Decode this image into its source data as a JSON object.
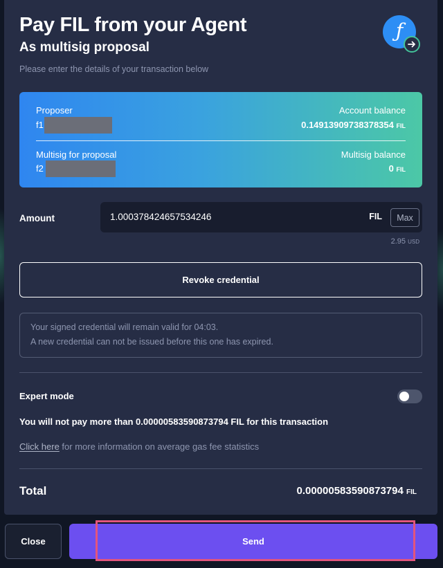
{
  "header": {
    "title": "Pay FIL from your Agent",
    "subtitle": "As multisig proposal",
    "instructions": "Please enter the details of your transaction below",
    "icon": "filecoin-icon",
    "badge_icon": "arrow-right-icon"
  },
  "card": {
    "proposer_label": "Proposer",
    "proposer_value": "f1",
    "account_balance_label": "Account balance",
    "account_balance_value": "0.14913909738378354",
    "account_balance_unit": "FIL",
    "multisig_label": "Multisig for proposal",
    "multisig_value": "f2",
    "multisig_balance_label": "Multisig balance",
    "multisig_balance_value": "0",
    "multisig_balance_unit": "FIL",
    "gradient": [
      "#2f86f0",
      "#4cc8a6"
    ]
  },
  "amount": {
    "label": "Amount",
    "value": "1.000378424657534246",
    "unit": "FIL",
    "max_label": "Max",
    "usd_value": "2.95",
    "usd_unit": "USD"
  },
  "revoke_label": "Revoke credential",
  "notice": {
    "line1": "Your signed credential will remain valid for 04:03.",
    "line2": "A new credential can not be issued before this one has expired."
  },
  "expert_mode": {
    "label": "Expert mode",
    "enabled": false
  },
  "gas": {
    "limit_text": "You will not pay more than 0.00000583590873794 FIL for this transaction",
    "link_text": "Click here",
    "info_text": " for more information on average gas fee statistics"
  },
  "total": {
    "label": "Total",
    "value": "0.00000583590873794",
    "unit": "FIL"
  },
  "footer": {
    "close_label": "Close",
    "send_label": "Send"
  },
  "colors": {
    "modal_bg": "#262d45",
    "send_button": "#6c4ff0",
    "highlight": "#e2557d"
  }
}
